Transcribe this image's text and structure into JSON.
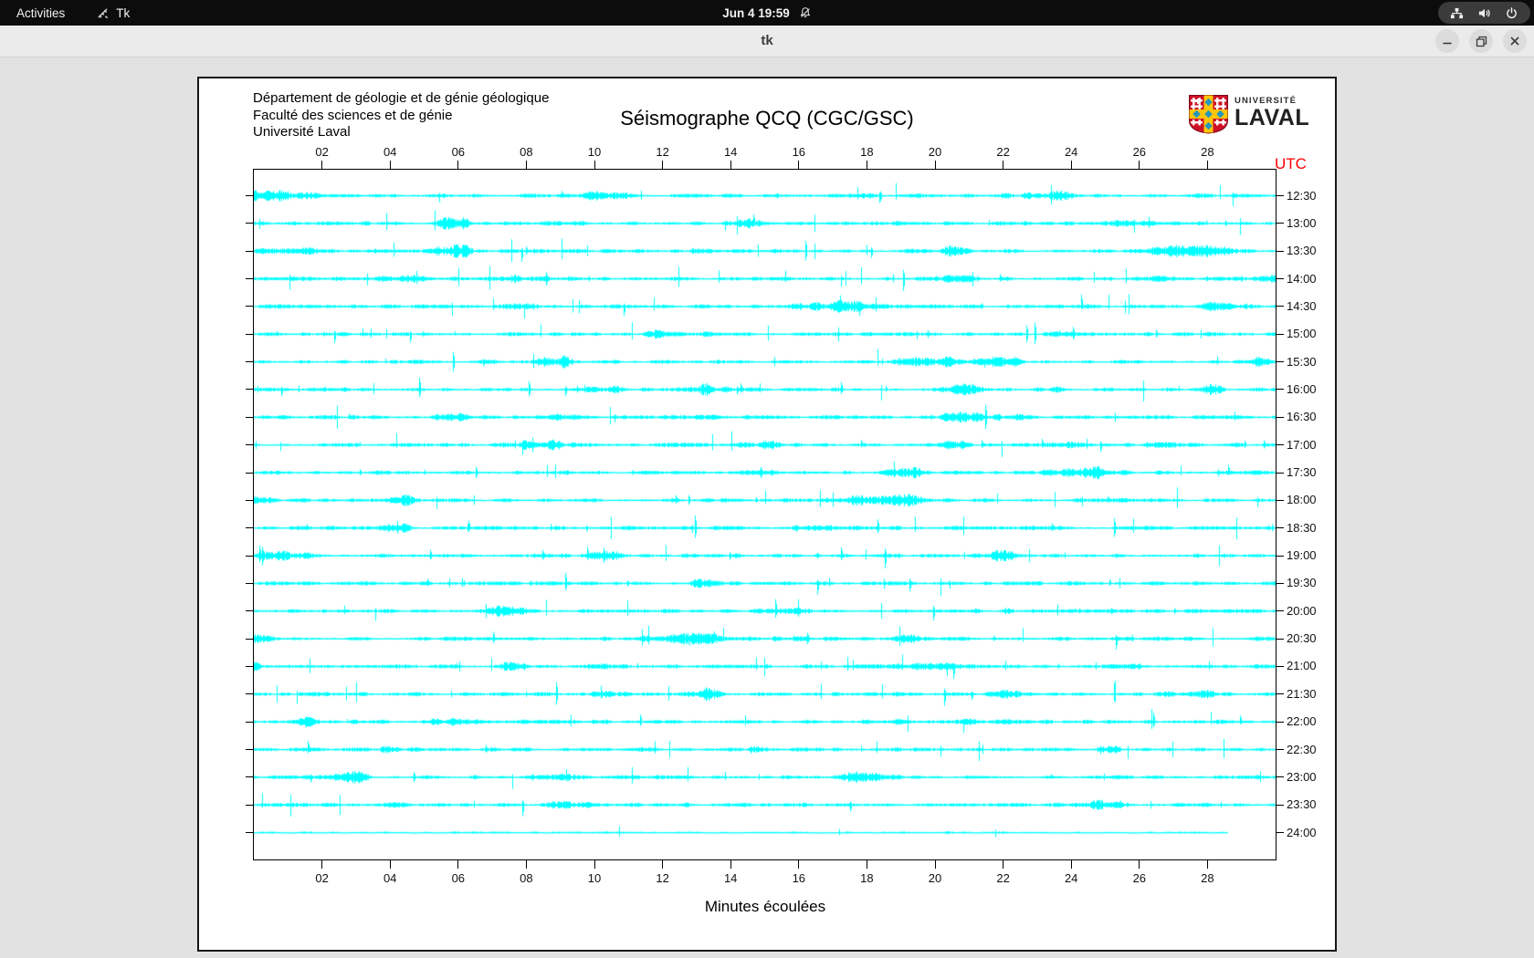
{
  "top_bar": {
    "activities": "Activities",
    "app_name": "Tk",
    "clock": "Jun 4  19:59"
  },
  "title_bar": {
    "title": "tk"
  },
  "header": {
    "address_lines": [
      "Département de géologie et de génie géologique",
      "Faculté des sciences et de génie",
      "Université Laval"
    ],
    "title": "Séismographe QCQ (CGC/GSC)",
    "logo_line1": "UNIVERSITÉ",
    "logo_line2": "LAVAL"
  },
  "chart_data": {
    "type": "line",
    "subtype": "seismogram-helicorder",
    "title": "Séismographe QCQ (CGC/GSC)",
    "xlabel": "Minutes écoulées",
    "right_axis_label": "UTC",
    "x_ticks": [
      "02",
      "04",
      "06",
      "08",
      "10",
      "12",
      "14",
      "16",
      "18",
      "20",
      "22",
      "24",
      "26",
      "28"
    ],
    "x_range_minutes": [
      0,
      30
    ],
    "rows": [
      "12:30",
      "13:00",
      "13:30",
      "14:00",
      "14:30",
      "15:00",
      "15:30",
      "16:00",
      "16:30",
      "17:00",
      "17:30",
      "18:00",
      "18:30",
      "19:00",
      "19:30",
      "20:00",
      "20:30",
      "21:00",
      "21:30",
      "22:00",
      "22:30",
      "23:00",
      "23:30",
      "24:00"
    ],
    "row_duration_minutes": 30,
    "last_row_end_minute": 28.6,
    "description": "24 half-hour seismic noise traces with sporadic spikes; amplitudes unlabeled"
  },
  "colors": {
    "trace": "#00ffff",
    "utc_label": "#ff0000",
    "laval_red": "#ce1126",
    "laval_gold": "#ffc609",
    "laval_blue": "#2596be"
  }
}
